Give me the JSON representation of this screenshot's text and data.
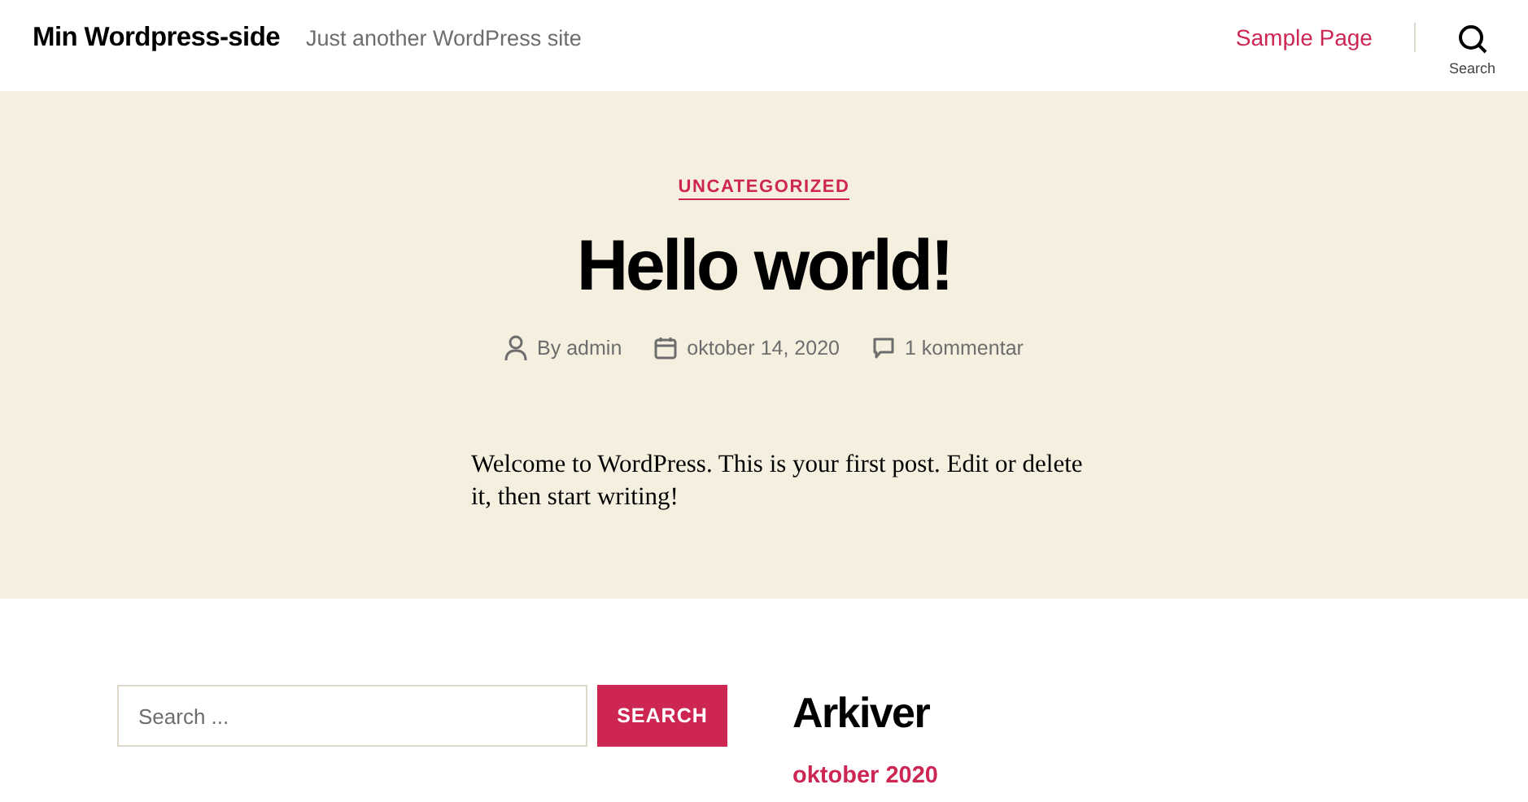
{
  "header": {
    "site_title": "Min Wordpress-side",
    "tagline": "Just another WordPress site",
    "nav": [
      {
        "label": "Sample Page"
      }
    ],
    "search_toggle": "Search"
  },
  "post": {
    "category": "UNCATEGORIZED",
    "title": "Hello world!",
    "author": "By admin",
    "date": "oktober 14, 2020",
    "comments": "1 kommentar",
    "body": "Welcome to WordPress. This is your first post. Edit or delete it, then start writing!"
  },
  "footer_widgets": {
    "search": {
      "placeholder": "Search ...",
      "button": "SEARCH"
    },
    "archive": {
      "heading": "Arkiver",
      "links": [
        "oktober 2020"
      ]
    }
  }
}
